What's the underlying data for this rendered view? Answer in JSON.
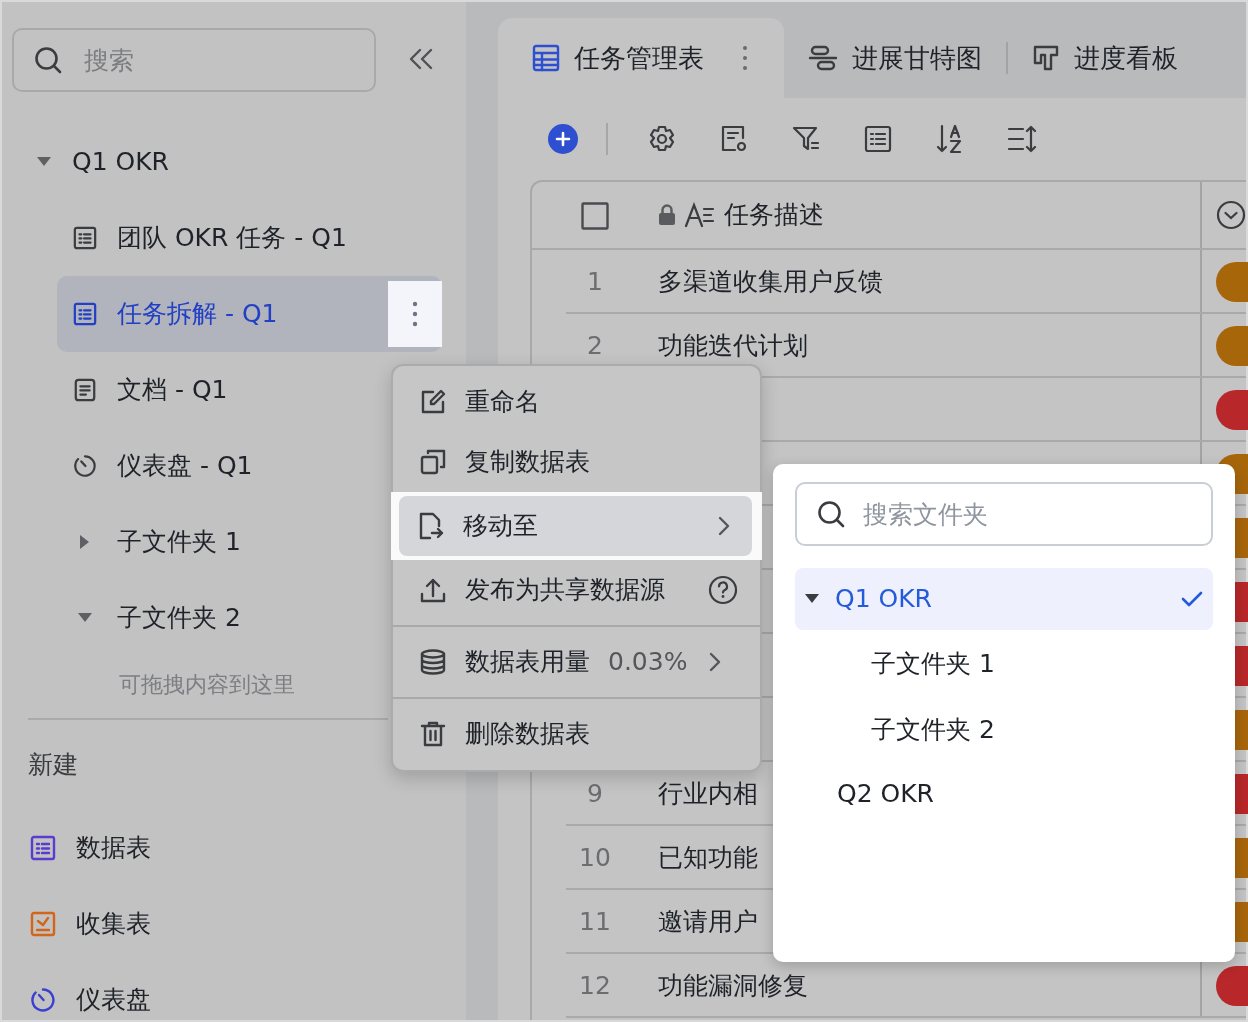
{
  "sidebar": {
    "search": {
      "placeholder": "搜索"
    },
    "tree": [
      {
        "label": "Q1 OKR",
        "kind": "folder",
        "expanded": true,
        "children": [
          {
            "label": "团队 OKR 任务 - Q1",
            "kind": "table",
            "selected": false
          },
          {
            "label": "任务拆解 - Q1",
            "kind": "table",
            "selected": true
          },
          {
            "label": "文档 - Q1",
            "kind": "doc",
            "selected": false
          },
          {
            "label": "仪表盘 - Q1",
            "kind": "dashboard",
            "selected": false
          },
          {
            "label": "子文件夹 1",
            "kind": "folder",
            "expanded": false
          },
          {
            "label": "子文件夹 2",
            "kind": "folder",
            "expanded": true,
            "empty_hint": "可拖拽内容到这里"
          }
        ]
      }
    ],
    "new_section": {
      "title": "新建",
      "items": [
        {
          "label": "数据表",
          "kind": "table"
        },
        {
          "label": "收集表",
          "kind": "form"
        },
        {
          "label": "仪表盘",
          "kind": "dashboard"
        }
      ]
    }
  },
  "view_tabs": [
    {
      "label": "任务管理表",
      "kind": "grid",
      "selected": true
    },
    {
      "label": "进展甘特图",
      "kind": "gantt",
      "selected": false
    },
    {
      "label": "进度看板",
      "kind": "kanban",
      "selected": false
    }
  ],
  "table": {
    "column_header": "任务描述",
    "rows": [
      {
        "number": "1",
        "text": "多渠道收集用户反馈",
        "color": "#a8660b"
      },
      {
        "number": "2",
        "text": "功能迭代计划",
        "color": "#a8660b"
      },
      {
        "color": "#b8282a"
      },
      {
        "color": "#a8660b"
      },
      {
        "color": "#a8660b"
      },
      {
        "color": "#b8282a"
      },
      {
        "color": "#b8282a"
      },
      {
        "color": "#a8660b"
      },
      {
        "number": "9",
        "text": "行业内相",
        "color": "#b8282a"
      },
      {
        "number": "10",
        "text": "已知功能",
        "color": "#a8660b"
      },
      {
        "number": "11",
        "text": "邀请用户",
        "color": "#a8660b"
      },
      {
        "number": "12",
        "text": "功能漏洞修复",
        "color": "#b8282a"
      }
    ]
  },
  "context_menu": {
    "groups": [
      [
        {
          "label": "重命名",
          "kind": "rename",
          "selected": false
        },
        {
          "label": "复制数据表",
          "kind": "copy",
          "selected": false
        },
        {
          "label": "移动至",
          "kind": "move",
          "selected": true,
          "submenu": true
        },
        {
          "label": "发布为共享数据源",
          "kind": "publish",
          "selected": false,
          "help": true
        }
      ],
      [
        {
          "label": "数据表用量",
          "kind": "usage",
          "selected": false,
          "value": "0.03%",
          "submenu": true
        }
      ],
      [
        {
          "label": "删除数据表",
          "kind": "delete",
          "selected": false
        }
      ]
    ]
  },
  "move_submenu": {
    "search": {
      "placeholder": "搜索文件夹"
    },
    "folders": [
      {
        "label": "Q1 OKR",
        "selected": true,
        "expanded": true,
        "children": [
          {
            "label": "子文件夹 1",
            "selected": false
          },
          {
            "label": "子文件夹 2",
            "selected": false
          }
        ]
      },
      {
        "label": "Q2 OKR",
        "selected": false
      }
    ]
  }
}
